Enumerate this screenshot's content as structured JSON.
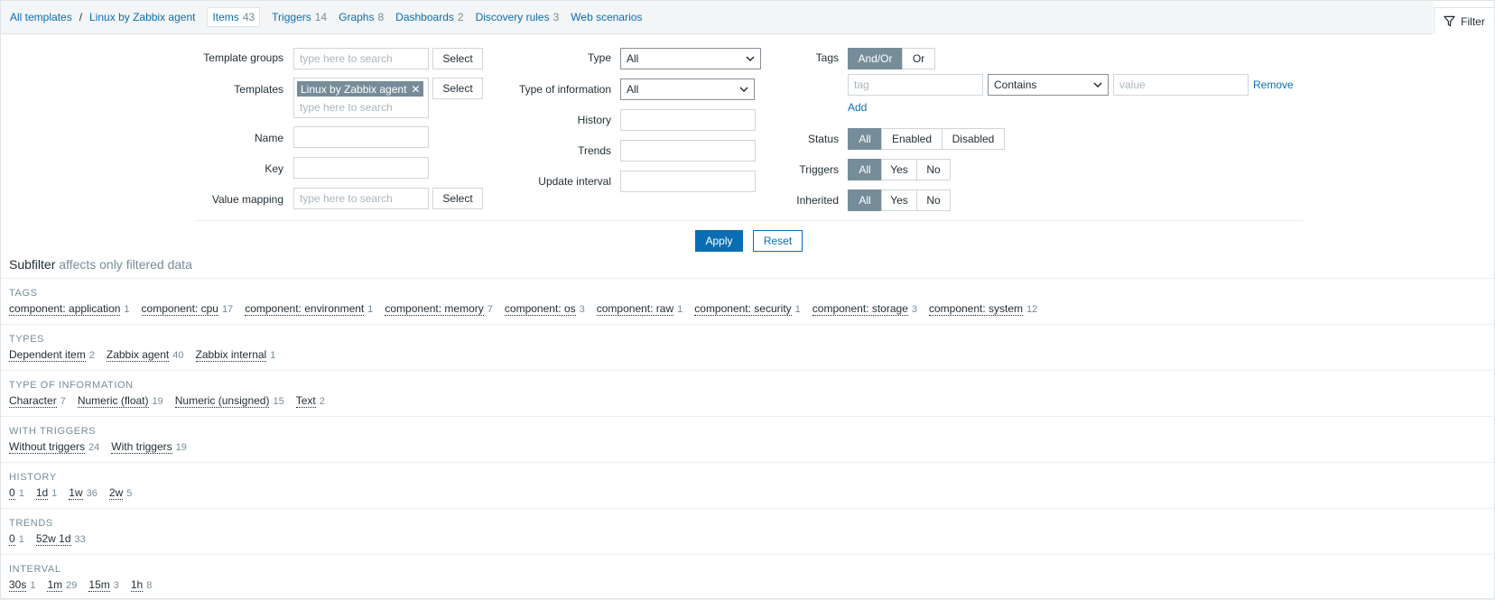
{
  "breadcrumb": {
    "all_templates": "All templates",
    "template": "Linux by Zabbix agent"
  },
  "tabs": [
    {
      "label": "Items",
      "count": "43"
    },
    {
      "label": "Triggers",
      "count": "14"
    },
    {
      "label": "Graphs",
      "count": "8"
    },
    {
      "label": "Dashboards",
      "count": "2"
    },
    {
      "label": "Discovery rules",
      "count": "3"
    },
    {
      "label": "Web scenarios",
      "count": ""
    }
  ],
  "filter_tab": "Filter",
  "form": {
    "template_groups": {
      "label": "Template groups",
      "placeholder": "type here to search",
      "button": "Select"
    },
    "templates": {
      "label": "Templates",
      "chip": "Linux by Zabbix agent",
      "placeholder": "type here to search",
      "button": "Select"
    },
    "name": {
      "label": "Name",
      "value": ""
    },
    "key": {
      "label": "Key",
      "value": ""
    },
    "value_mapping": {
      "label": "Value mapping",
      "placeholder": "type here to search",
      "button": "Select"
    },
    "type": {
      "label": "Type",
      "value": "All"
    },
    "type_of_information": {
      "label": "Type of information",
      "value": "All"
    },
    "history": {
      "label": "History",
      "value": ""
    },
    "trends": {
      "label": "Trends",
      "value": ""
    },
    "update_interval": {
      "label": "Update interval",
      "value": ""
    },
    "tags": {
      "label": "Tags",
      "mode": [
        "And/Or",
        "Or"
      ],
      "tag_placeholder": "tag",
      "operator": "Contains",
      "value_placeholder": "value",
      "remove": "Remove",
      "add": "Add"
    },
    "status": {
      "label": "Status",
      "options": [
        "All",
        "Enabled",
        "Disabled"
      ]
    },
    "triggers": {
      "label": "Triggers",
      "options": [
        "All",
        "Yes",
        "No"
      ]
    },
    "inherited": {
      "label": "Inherited",
      "options": [
        "All",
        "Yes",
        "No"
      ]
    },
    "apply": "Apply",
    "reset": "Reset"
  },
  "subfilter": {
    "title": "Subfilter",
    "note": "affects only filtered data",
    "sections": [
      {
        "name": "TAGS",
        "items": [
          {
            "label": "component: application",
            "count": "1"
          },
          {
            "label": "component: cpu",
            "count": "17"
          },
          {
            "label": "component: environment",
            "count": "1"
          },
          {
            "label": "component: memory",
            "count": "7"
          },
          {
            "label": "component: os",
            "count": "3"
          },
          {
            "label": "component: raw",
            "count": "1"
          },
          {
            "label": "component: security",
            "count": "1"
          },
          {
            "label": "component: storage",
            "count": "3"
          },
          {
            "label": "component: system",
            "count": "12"
          }
        ]
      },
      {
        "name": "TYPES",
        "items": [
          {
            "label": "Dependent item",
            "count": "2"
          },
          {
            "label": "Zabbix agent",
            "count": "40"
          },
          {
            "label": "Zabbix internal",
            "count": "1"
          }
        ]
      },
      {
        "name": "TYPE OF INFORMATION",
        "items": [
          {
            "label": "Character",
            "count": "7"
          },
          {
            "label": "Numeric (float)",
            "count": "19"
          },
          {
            "label": "Numeric (unsigned)",
            "count": "15"
          },
          {
            "label": "Text",
            "count": "2"
          }
        ]
      },
      {
        "name": "WITH TRIGGERS",
        "items": [
          {
            "label": "Without triggers",
            "count": "24"
          },
          {
            "label": "With triggers",
            "count": "19"
          }
        ]
      },
      {
        "name": "HISTORY",
        "items": [
          {
            "label": "0",
            "count": "1"
          },
          {
            "label": "1d",
            "count": "1"
          },
          {
            "label": "1w",
            "count": "36"
          },
          {
            "label": "2w",
            "count": "5"
          }
        ]
      },
      {
        "name": "TRENDS",
        "items": [
          {
            "label": "0",
            "count": "1"
          },
          {
            "label": "52w 1d",
            "count": "33"
          }
        ]
      },
      {
        "name": "INTERVAL",
        "items": [
          {
            "label": "30s",
            "count": "1"
          },
          {
            "label": "1m",
            "count": "29"
          },
          {
            "label": "15m",
            "count": "3"
          },
          {
            "label": "1h",
            "count": "8"
          }
        ]
      }
    ]
  }
}
